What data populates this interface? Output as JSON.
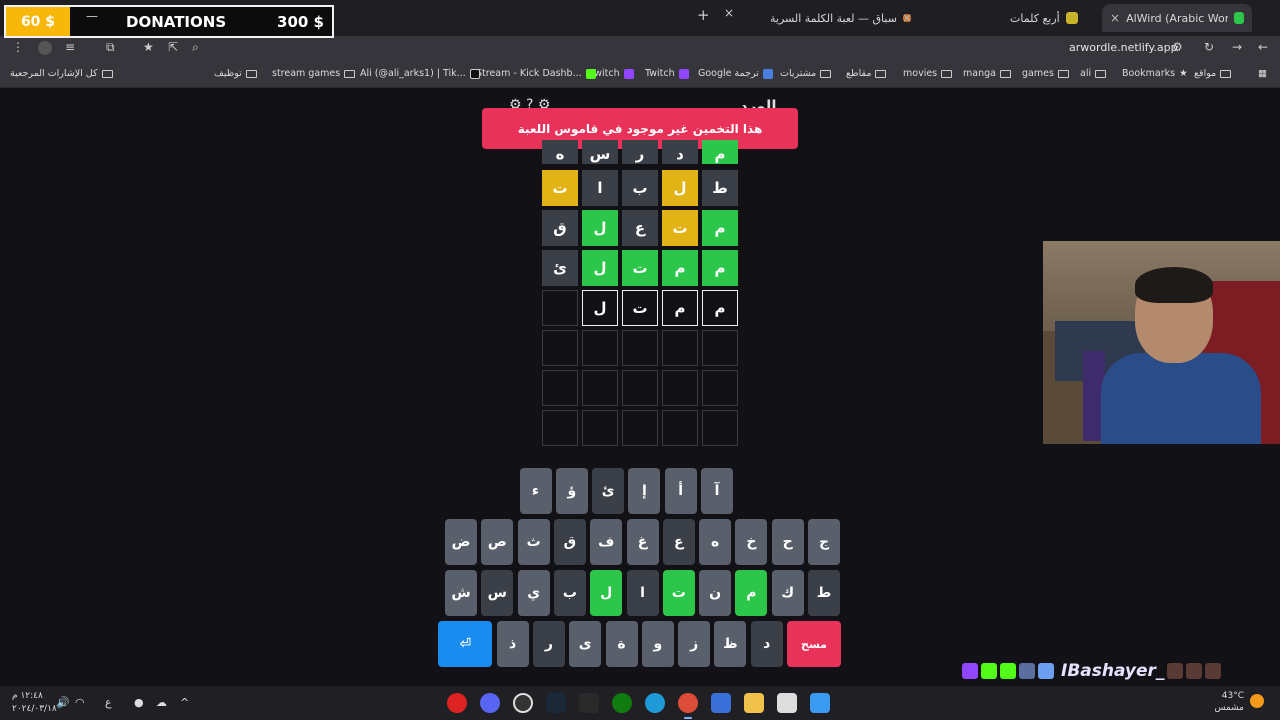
{
  "donations": {
    "amount": "60 $",
    "title": "DONATIONS",
    "goal": "300 $",
    "minimize": "—"
  },
  "tabs": [
    {
      "label": "AlWird (Arabic Wordle) - الورد",
      "active": true,
      "fav_color": "#2cc74a"
    },
    {
      "label": "أربع كلمات",
      "active": false,
      "fav_color": "#c8b42a"
    },
    {
      "label": "سباق — لعبة الكلمة السرية",
      "active": false,
      "fav_color": "#c9702a"
    }
  ],
  "tab_controls": {
    "new_tab": "+",
    "close": "×"
  },
  "address_bar": {
    "url": "arwordle.netlify.app"
  },
  "toolbar_icons": [
    "back-icon",
    "forward-icon",
    "reload-icon",
    "site-settings-icon",
    "search-icon",
    "share-icon",
    "bookmark-star-icon",
    "extensions-icon",
    "profile-icon",
    "menu-icon"
  ],
  "bookmarks": [
    {
      "label": "مواقع",
      "type": "folder"
    },
    {
      "label": "Bookmarks",
      "type": "star"
    },
    {
      "label": "ali",
      "type": "folder"
    },
    {
      "label": "games",
      "type": "folder"
    },
    {
      "label": "manga",
      "type": "folder"
    },
    {
      "label": "movies",
      "type": "folder"
    },
    {
      "label": "مقاطع",
      "type": "folder"
    },
    {
      "label": "مشتريات",
      "type": "folder"
    },
    {
      "label": "Google ترجمة",
      "type": "site"
    },
    {
      "label": "Twitch",
      "type": "site"
    },
    {
      "label": "Twitch",
      "type": "site"
    },
    {
      "label": "Stream - Kick Dashb...",
      "type": "site"
    },
    {
      "label": "Ali (@ali_arks1) | Tik...",
      "type": "site"
    },
    {
      "label": "stream games",
      "type": "folder"
    },
    {
      "label": "توظيف",
      "type": "folder"
    },
    {
      "label": "كل الإشارات المرجعية",
      "type": "folder"
    }
  ],
  "game": {
    "title": "الورد",
    "toast": "هذا التخمين غير موجود في قاموس اللعبة",
    "board": [
      [
        {
          "l": "م",
          "s": "correct"
        },
        {
          "l": "د",
          "s": "absent"
        },
        {
          "l": "ر",
          "s": "absent"
        },
        {
          "l": "س",
          "s": "absent"
        },
        {
          "l": "ه",
          "s": "absent"
        }
      ],
      [
        {
          "l": "ط",
          "s": "absent"
        },
        {
          "l": "ل",
          "s": "present"
        },
        {
          "l": "ب",
          "s": "absent"
        },
        {
          "l": "ا",
          "s": "absent"
        },
        {
          "l": "ت",
          "s": "present"
        }
      ],
      [
        {
          "l": "م",
          "s": "correct"
        },
        {
          "l": "ت",
          "s": "present"
        },
        {
          "l": "ع",
          "s": "absent"
        },
        {
          "l": "ل",
          "s": "correct"
        },
        {
          "l": "ق",
          "s": "absent"
        }
      ],
      [
        {
          "l": "م",
          "s": "correct"
        },
        {
          "l": "م",
          "s": "correct"
        },
        {
          "l": "ت",
          "s": "correct"
        },
        {
          "l": "ل",
          "s": "correct"
        },
        {
          "l": "ئ",
          "s": "absent"
        }
      ],
      [
        {
          "l": "م",
          "s": "typed"
        },
        {
          "l": "م",
          "s": "typed"
        },
        {
          "l": "ت",
          "s": "typed"
        },
        {
          "l": "ل",
          "s": "typed"
        },
        {
          "l": "",
          "s": "empty"
        }
      ],
      [
        {
          "l": "",
          "s": "empty"
        },
        {
          "l": "",
          "s": "empty"
        },
        {
          "l": "",
          "s": "empty"
        },
        {
          "l": "",
          "s": "empty"
        },
        {
          "l": "",
          "s": "empty"
        }
      ],
      [
        {
          "l": "",
          "s": "empty"
        },
        {
          "l": "",
          "s": "empty"
        },
        {
          "l": "",
          "s": "empty"
        },
        {
          "l": "",
          "s": "empty"
        },
        {
          "l": "",
          "s": "empty"
        }
      ],
      [
        {
          "l": "",
          "s": "empty"
        },
        {
          "l": "",
          "s": "empty"
        },
        {
          "l": "",
          "s": "empty"
        },
        {
          "l": "",
          "s": "empty"
        },
        {
          "l": "",
          "s": "empty"
        }
      ]
    ],
    "keyboard": {
      "row1": [
        {
          "k": "آ",
          "s": "plain"
        },
        {
          "k": "أ",
          "s": "plain"
        },
        {
          "k": "إ",
          "s": "plain"
        },
        {
          "k": "ئ",
          "s": "dark"
        },
        {
          "k": "ؤ",
          "s": "plain"
        },
        {
          "k": "ء",
          "s": "plain"
        }
      ],
      "row2": [
        {
          "k": "ج",
          "s": "plain"
        },
        {
          "k": "ح",
          "s": "plain"
        },
        {
          "k": "خ",
          "s": "plain"
        },
        {
          "k": "ه",
          "s": "plain"
        },
        {
          "k": "ع",
          "s": "dark"
        },
        {
          "k": "غ",
          "s": "plain"
        },
        {
          "k": "ف",
          "s": "plain"
        },
        {
          "k": "ق",
          "s": "dark"
        },
        {
          "k": "ث",
          "s": "plain"
        },
        {
          "k": "ص",
          "s": "plain"
        },
        {
          "k": "ض",
          "s": "plain"
        }
      ],
      "row3": [
        {
          "k": "ط",
          "s": "dark"
        },
        {
          "k": "ك",
          "s": "plain"
        },
        {
          "k": "م",
          "s": "correct"
        },
        {
          "k": "ن",
          "s": "plain"
        },
        {
          "k": "ت",
          "s": "correct"
        },
        {
          "k": "ا",
          "s": "dark"
        },
        {
          "k": "ل",
          "s": "correct"
        },
        {
          "k": "ب",
          "s": "dark"
        },
        {
          "k": "ي",
          "s": "plain"
        },
        {
          "k": "س",
          "s": "dark"
        },
        {
          "k": "ش",
          "s": "plain"
        }
      ],
      "row4": [
        {
          "k": "مسح",
          "s": "del"
        },
        {
          "k": "د",
          "s": "dark"
        },
        {
          "k": "ظ",
          "s": "plain"
        },
        {
          "k": "ز",
          "s": "plain"
        },
        {
          "k": "و",
          "s": "plain"
        },
        {
          "k": "ة",
          "s": "plain"
        },
        {
          "k": "ى",
          "s": "plain"
        },
        {
          "k": "ر",
          "s": "dark"
        },
        {
          "k": "ذ",
          "s": "plain"
        },
        {
          "k": "⏎",
          "s": "enter"
        }
      ]
    }
  },
  "stream_overlay": {
    "streamer_name": "IBashayer_"
  },
  "taskbar": {
    "apps": [
      "adobe-icon",
      "discord-icon",
      "obs-icon",
      "steam-icon",
      "epic-icon",
      "xbox-icon",
      "edge-icon",
      "chrome-icon",
      "store-icon",
      "explorer-icon",
      "file-icon",
      "start-icon"
    ],
    "clock_time": "١٢:٤٨ م",
    "clock_date": "٢٠٢٤/٠٣/١٨",
    "language": "ع",
    "weather_temp": "43°C",
    "weather_desc": "مشمس"
  },
  "colors": {
    "correct": "#2cc74a",
    "present": "#e2b314",
    "absent": "#3a3f48",
    "toast": "#e8325a",
    "enter": "#1a8cf0"
  }
}
